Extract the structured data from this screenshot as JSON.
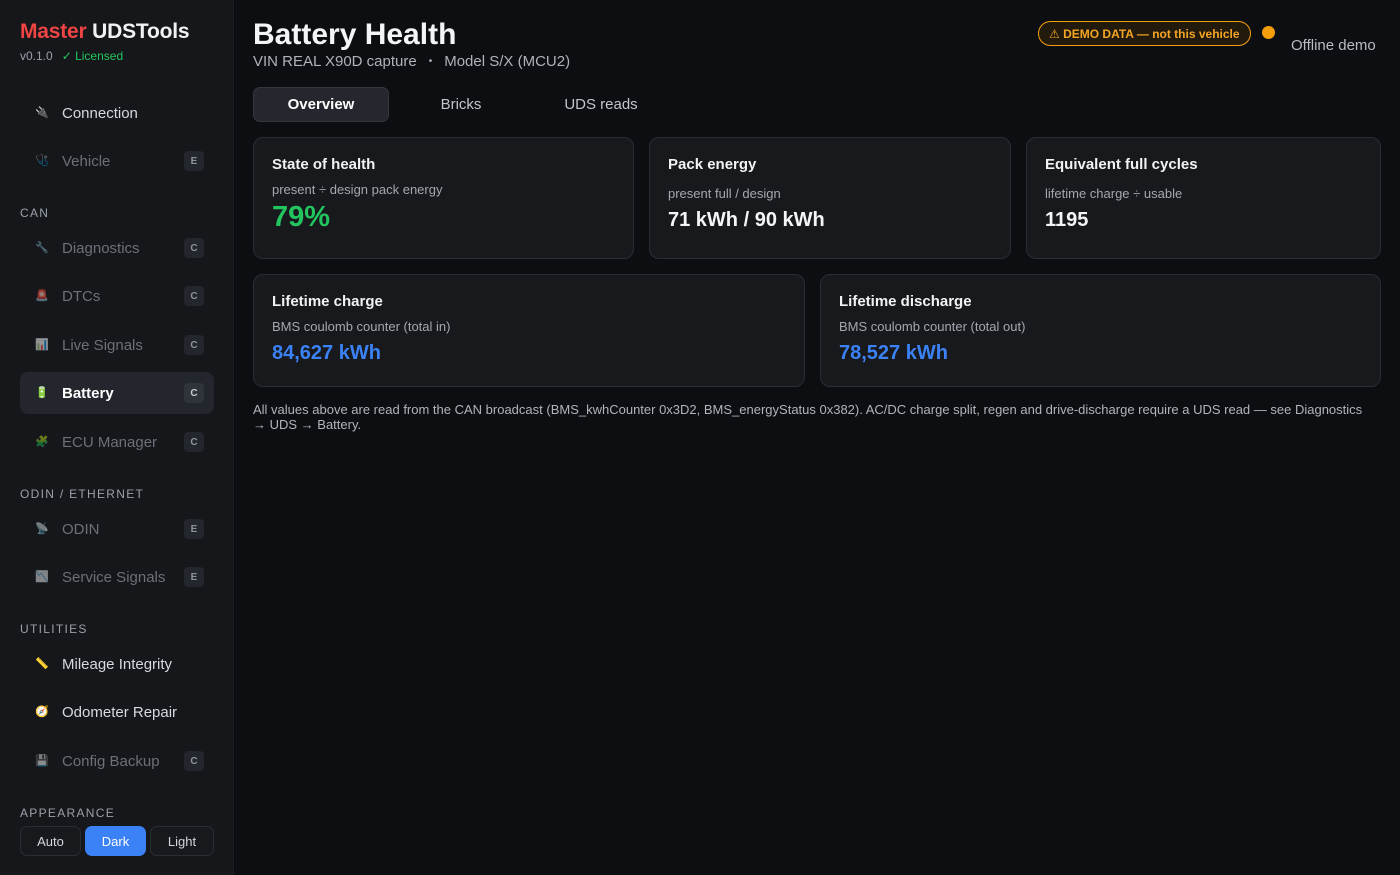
{
  "brand": {
    "part1": "Master",
    "part2": "UDSTools",
    "version": "v0.1.0",
    "license": "✓ Licensed"
  },
  "sidebar": {
    "items": [
      {
        "label": "Connection",
        "icon": "plug-icon",
        "glyph": "🔌",
        "badge": ""
      },
      {
        "label": "Vehicle",
        "icon": "stethoscope-icon",
        "glyph": "🩺",
        "badge": "E"
      },
      {
        "label": "Diagnostics",
        "icon": "wrench-icon",
        "glyph": "🔧",
        "badge": "C"
      },
      {
        "label": "DTCs",
        "icon": "alarm-light-icon",
        "glyph": "🚨",
        "badge": "C"
      },
      {
        "label": "Live Signals",
        "icon": "bar-chart-icon",
        "glyph": "📊",
        "badge": "C"
      },
      {
        "label": "Battery",
        "icon": "battery-icon",
        "glyph": "🔋",
        "badge": "C"
      },
      {
        "label": "ECU Manager",
        "icon": "puzzle-icon",
        "glyph": "🧩",
        "badge": "C"
      },
      {
        "label": "ODIN",
        "icon": "satellite-icon",
        "glyph": "📡",
        "badge": "E"
      },
      {
        "label": "Service Signals",
        "icon": "signal-chart-icon",
        "glyph": "📉",
        "badge": "E"
      },
      {
        "label": "Mileage Integrity",
        "icon": "ruler-icon",
        "glyph": "📏",
        "badge": ""
      },
      {
        "label": "Odometer Repair",
        "icon": "gauge-icon",
        "glyph": "🧭",
        "badge": ""
      },
      {
        "label": "Config Backup",
        "icon": "floppy-disk-icon",
        "glyph": "💾",
        "badge": "C"
      }
    ],
    "sections": {
      "can": "CAN",
      "odin": "ODIN / ETHERNET",
      "utilities": "UTILITIES",
      "appearance": "APPEARANCE"
    },
    "appearance": {
      "auto": "Auto",
      "dark": "Dark",
      "light": "Light",
      "selected": "Dark"
    }
  },
  "header": {
    "title": "Battery Health",
    "vin": "VIN REAL X90D capture",
    "separator": "•",
    "model": "Model S/X (MCU2)",
    "demo_badge": "⚠ DEMO DATA — not this vehicle",
    "status": "Offline demo",
    "status_color": "#f59e0b"
  },
  "tabs": [
    {
      "label": "Overview",
      "active": true
    },
    {
      "label": "Bricks",
      "active": false
    },
    {
      "label": "UDS reads",
      "active": false
    }
  ],
  "cards": {
    "soh": {
      "title": "State of health",
      "sub": "present ÷ design pack energy",
      "value": "79%"
    },
    "pack": {
      "title": "Pack energy",
      "sub": "present full / design",
      "value": "71 kWh / 90 kWh"
    },
    "cycles": {
      "title": "Equivalent full cycles",
      "sub": "lifetime charge ÷ usable",
      "value": "1195"
    },
    "charge": {
      "title": "Lifetime charge",
      "sub": "BMS coulomb counter (total in)",
      "value": "84,627 kWh"
    },
    "discharge": {
      "title": "Lifetime discharge",
      "sub": "BMS coulomb counter (total out)",
      "value": "78,527 kWh"
    }
  },
  "footnote": "All values above are read from the CAN broadcast (BMS_kwhCounter 0x3D2, BMS_energyStatus 0x382). AC/DC charge split, regen and drive-discharge require a UDS read — see Diagnostics → UDS → Battery.",
  "colors": {
    "accent": "#3b82f6",
    "good": "#22c55e",
    "warn": "#f59e0b",
    "brand_red": "#ef4444"
  }
}
